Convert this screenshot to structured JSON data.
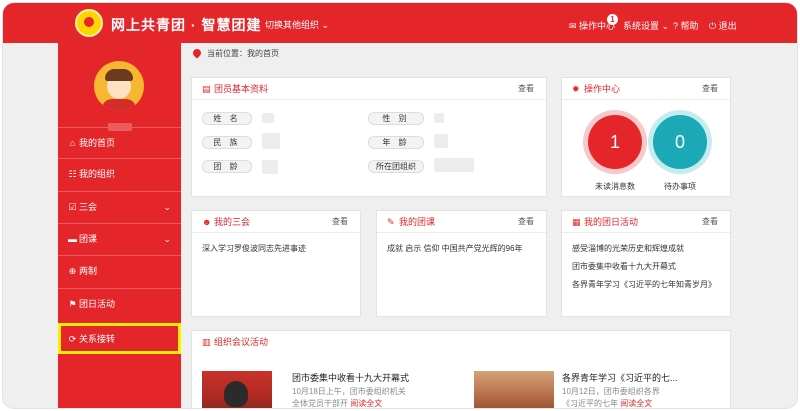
{
  "header": {
    "site_title": "网上共青团 · 智慧团建",
    "switch_org": "切换其他组织 ⌄",
    "ops_center": "✉ 操作中心",
    "ops_badge": "1",
    "settings": "系统设置 ⌄",
    "help": "? 帮助",
    "logout": "⏻ 退出"
  },
  "sidebar": {
    "items": [
      {
        "icon": "⌂",
        "label": "我的首页",
        "chevron": ""
      },
      {
        "icon": "☷",
        "label": "我的组织",
        "chevron": ""
      },
      {
        "icon": "☑",
        "label": "三会",
        "chevron": "⌄"
      },
      {
        "icon": "▬",
        "label": "团课",
        "chevron": "⌄"
      },
      {
        "icon": "⊕",
        "label": "两制",
        "chevron": ""
      },
      {
        "icon": "⚑",
        "label": "团日活动",
        "chevron": ""
      },
      {
        "icon": "⟳",
        "label": "关系接转",
        "chevron": ""
      }
    ]
  },
  "breadcrumb": "当前位置：我的首页",
  "member_card": {
    "title": "团员基本资料",
    "more": "查看",
    "labels": [
      "姓 名",
      "性 别",
      "民 族",
      "年 龄",
      "团 龄",
      "所在团组织"
    ]
  },
  "ops_card": {
    "title": "操作中心",
    "more": "查看",
    "unread_count": "1",
    "unread_label": "未读消息数",
    "todo_count": "0",
    "todo_label": "待办事项"
  },
  "sanhui_card": {
    "title": "我的三会",
    "more": "查看",
    "lines": [
      "深入学习罗俊波同志先进事迹"
    ]
  },
  "tuanke_card": {
    "title": "我的团课",
    "more": "查看",
    "lines": [
      "成就 启示 信仰 中国共产党光辉的96年"
    ]
  },
  "tuanri_card": {
    "title": "我的团日活动",
    "more": "查看",
    "lines": [
      "感受淄博的光荣历史和辉煌成就",
      "团市委集中收看十九大开幕式",
      "各界青年学习《习近平的七年知青岁月》"
    ]
  },
  "meeting_card": {
    "title": "组织会议活动",
    "news": [
      {
        "title": "团市委集中收看十九大开幕式",
        "sub1": "10月18日上午，团市委组织机关",
        "sub2": "全体党员干部开",
        "read": "阅读全文"
      },
      {
        "title": "各界青年学习《习近平的七...",
        "sub1": "10月12日，团市委组织各界",
        "sub2": "《习近平的七年",
        "read": "阅读全文"
      }
    ]
  },
  "colors": {
    "brand_red": "#e4262b",
    "teal": "#1aa9b5",
    "highlight": "#ffee00"
  }
}
